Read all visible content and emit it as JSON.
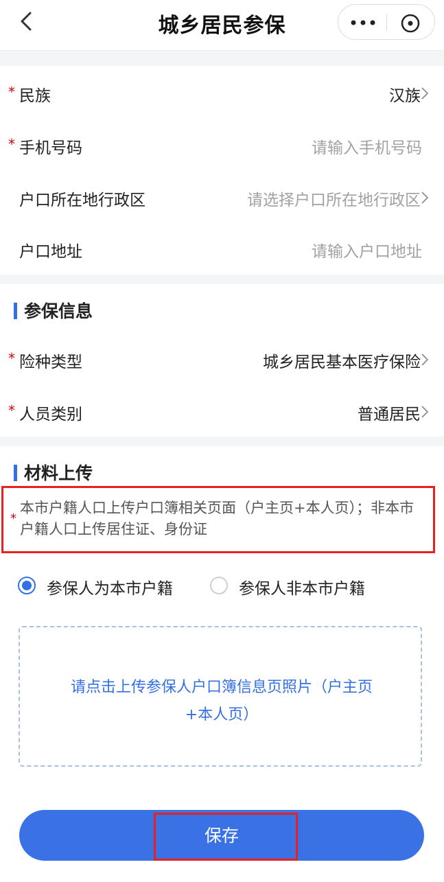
{
  "header": {
    "title": "城乡居民参保",
    "back_icon": "chevron-left-icon",
    "more_icon": "more-icon",
    "close_icon": "close-circle-icon"
  },
  "basic_info": {
    "rows": [
      {
        "label": "民族",
        "value": "汉族",
        "required": "*"
      },
      {
        "label": "手机号码",
        "placeholder": "请输入手机号码",
        "required": "*"
      },
      {
        "label": "户口所在地行政区",
        "placeholder": "请选择户口所在地行政区"
      },
      {
        "label": "户口地址",
        "placeholder": "请输入户口地址"
      }
    ]
  },
  "insurance_info": {
    "title": "参保信息",
    "rows": [
      {
        "label": "险种类型",
        "value": "城乡居民基本医疗保险",
        "required": "*"
      },
      {
        "label": "人员类别",
        "value": "普通居民",
        "required": "*"
      }
    ]
  },
  "materials": {
    "title": "材料上传",
    "notice_required": "*",
    "notice": "本市户籍人口上传户口簿相关页面（户主页+本人页）；非本市户籍人口上传居住证、身份证",
    "radios": [
      {
        "label": "参保人为本市户籍",
        "selected": true
      },
      {
        "label": "参保人非本市户籍",
        "selected": false
      }
    ],
    "upload_line1": "请点击上传参保人户口簿信息页照片（户主页",
    "upload_line2": "+本人页）"
  },
  "save_button": {
    "label": "保存"
  },
  "colors": {
    "accent": "#3470e4",
    "required": "#d0021b",
    "highlight": "#e8201f"
  }
}
